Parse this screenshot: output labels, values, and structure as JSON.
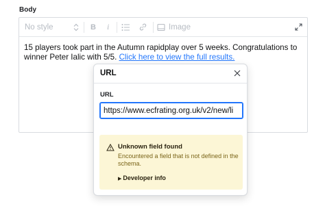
{
  "field": {
    "label": "Body"
  },
  "toolbar": {
    "style_select": "No style",
    "bold_label": "B",
    "italic_label": "i",
    "image_label": "Image"
  },
  "content": {
    "text": "15 players took part in the Autumn rapidplay over 5 weeks. Congratulations to winner Peter Ialic with 5/5.",
    "link_text": "Click here to view the full results."
  },
  "popover": {
    "title": "URL",
    "url_label": "URL",
    "url_value": "https://www.ecfrating.org.uk/v2/new/li"
  },
  "warning": {
    "title": "Unknown field found",
    "description": "Encountered a field that is not defined in the schema.",
    "toggle_label": "Developer info"
  },
  "colors": {
    "accent": "#2276fc",
    "warning_bg": "#fcf6d6",
    "warning_text": "#7a6418"
  },
  "icons": [
    "chevron-up-down-icon",
    "bulleted-list-icon",
    "link-icon",
    "image-icon",
    "expand-icon",
    "close-icon",
    "warning-triangle-icon",
    "disclosure-triangle-icon"
  ]
}
